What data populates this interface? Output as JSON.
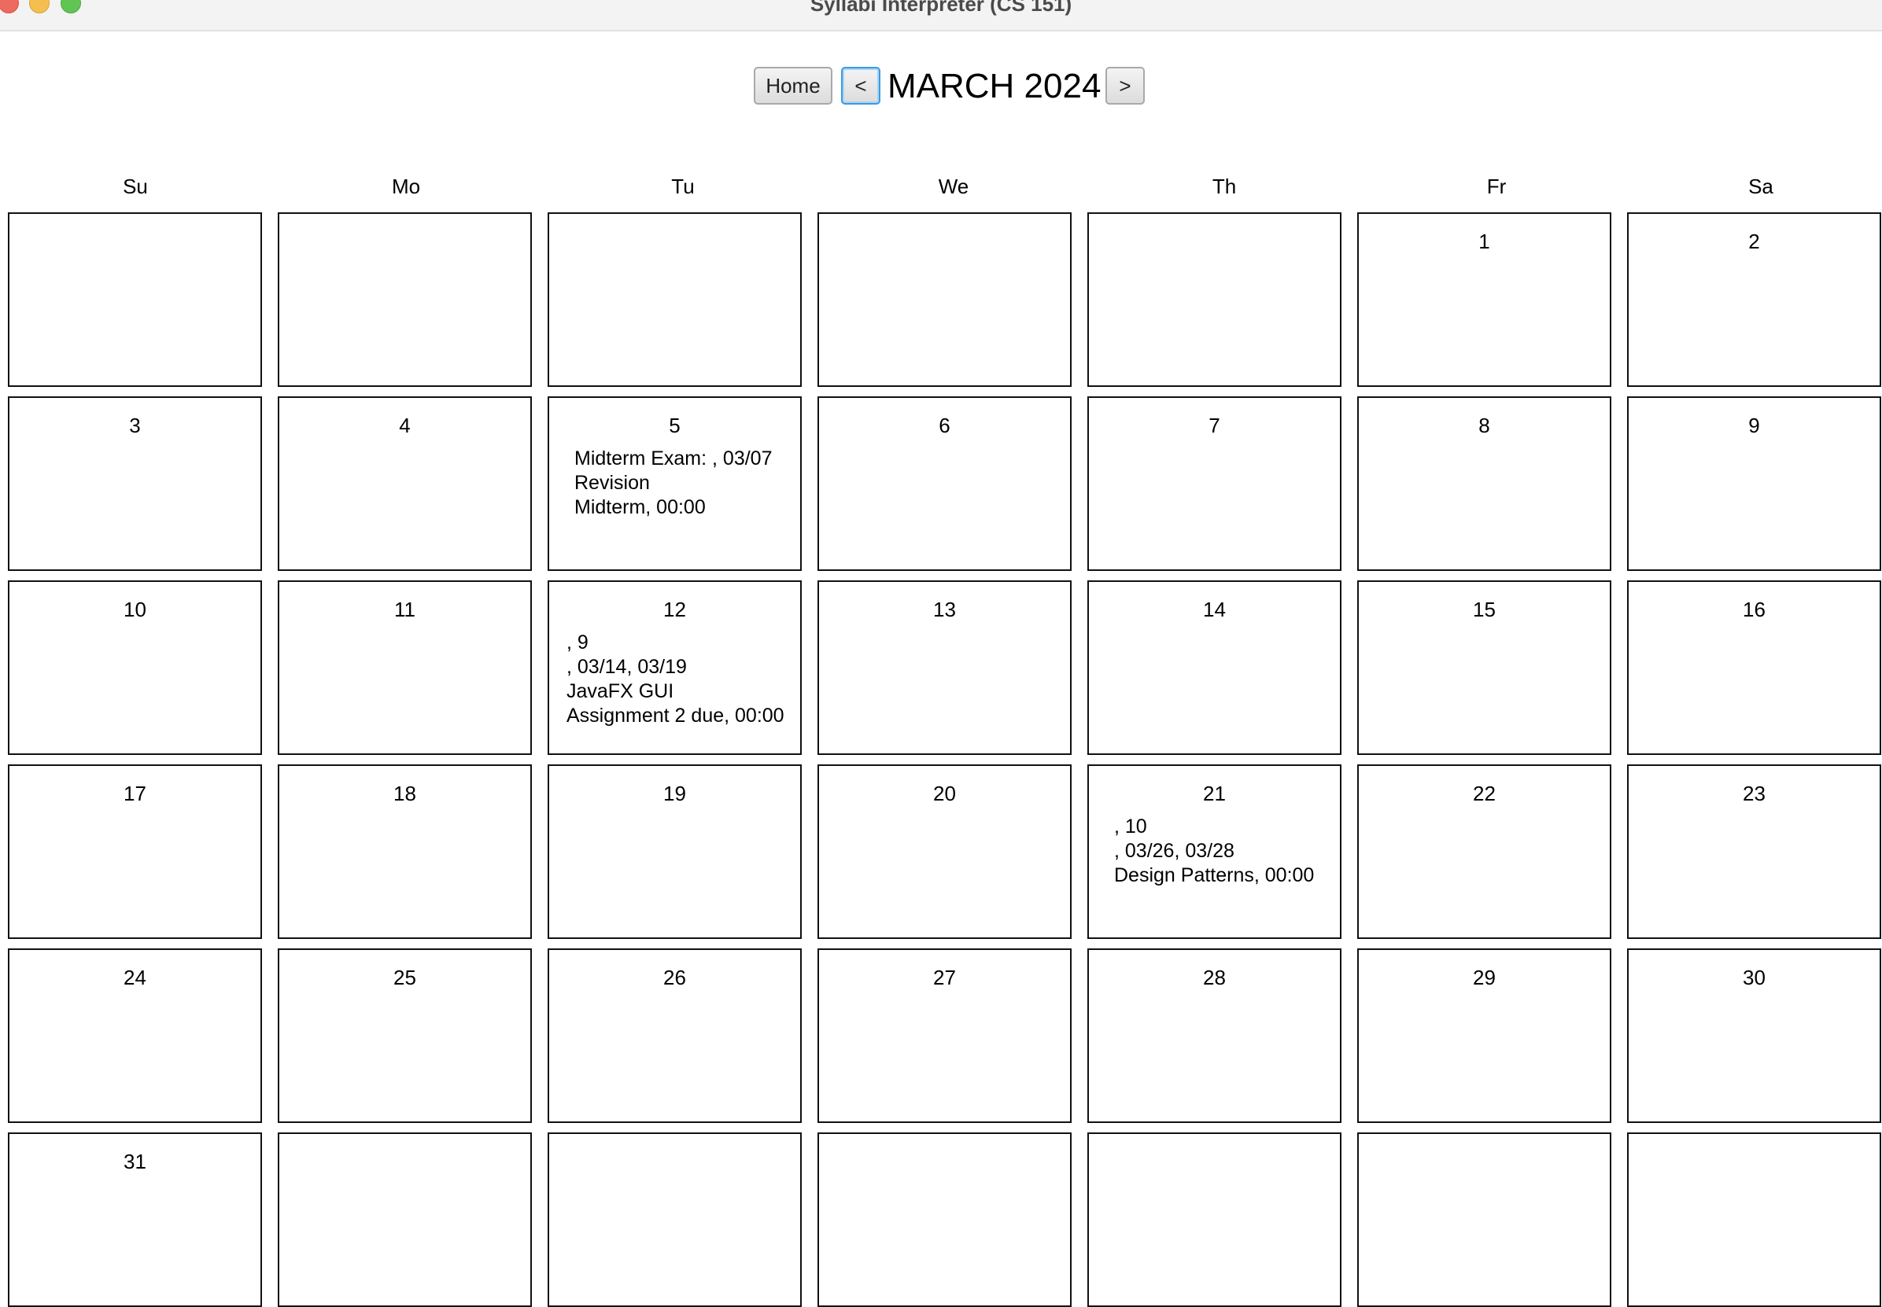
{
  "window": {
    "title": "Syllabi Interpreter (CS 151)"
  },
  "toolbar": {
    "home_label": "Home",
    "prev_label": "<",
    "next_label": ">",
    "month_label": "MARCH 2024"
  },
  "weekdays": [
    "Su",
    "Mo",
    "Tu",
    "We",
    "Th",
    "Fr",
    "Sa"
  ],
  "days": [
    "",
    "",
    "",
    "",
    "",
    "1",
    "2",
    "3",
    "4",
    "5",
    "6",
    "7",
    "8",
    "9",
    "10",
    "11",
    "12",
    "13",
    "14",
    "15",
    "16",
    "17",
    "18",
    "19",
    "20",
    "21",
    "22",
    "23",
    "24",
    "25",
    "26",
    "27",
    "28",
    "29",
    "30",
    "31",
    "",
    "",
    "",
    "",
    "",
    ""
  ],
  "events": {
    "mar5": "Midterm Exam: , 03/07\nRevision\nMidterm, 00:00",
    "mar12": ", 9\n, 03/14, 03/19\nJavaFX GUI\nAssignment 2 due, 00:00",
    "mar21": ", 10\n, 03/26, 03/28\nDesign Patterns, 00:00"
  }
}
